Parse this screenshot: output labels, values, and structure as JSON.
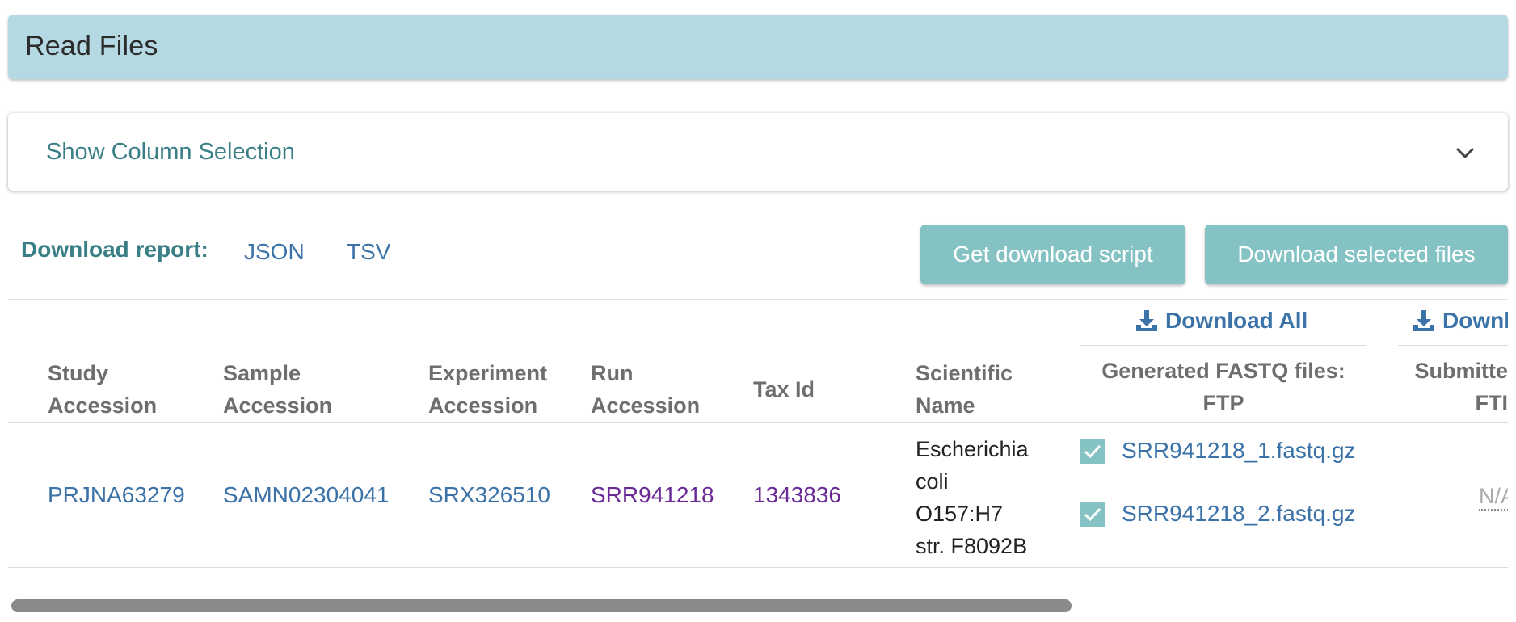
{
  "header": {
    "title": "Read Files"
  },
  "column_selection": {
    "label": "Show Column Selection",
    "icon": "chevron-down-icon"
  },
  "report": {
    "label": "Download report:",
    "json": "JSON",
    "tsv": "TSV"
  },
  "buttons": {
    "get_script": "Get download script",
    "download_selected": "Download selected files"
  },
  "table": {
    "download_all": "Download All",
    "download_all_partial": "Downl",
    "headers": {
      "study": [
        "Study",
        "Accession"
      ],
      "sample": [
        "Sample",
        "Accession"
      ],
      "experiment": [
        "Experiment",
        "Accession"
      ],
      "run": [
        "Run",
        "Accession"
      ],
      "tax": "Tax Id",
      "scientific": [
        "Scientific",
        "Name"
      ],
      "fastq": [
        "Generated FASTQ files:",
        "FTP"
      ],
      "submitted": [
        "Submitte",
        "FTI"
      ]
    },
    "row": {
      "study": "PRJNA63279",
      "sample": "SAMN02304041",
      "experiment": "SRX326510",
      "run": "SRR941218",
      "tax_id": "1343836",
      "scientific_name": [
        "Escherichia",
        "coli",
        "O157:H7",
        "str. F8092B"
      ],
      "files": [
        {
          "name": "SRR941218_1.fastq.gz",
          "checked": true
        },
        {
          "name": "SRR941218_2.fastq.gz",
          "checked": true
        }
      ],
      "submitted": "N/A"
    }
  },
  "colors": {
    "header_bg": "#b5d9e3",
    "accent": "#3a7f86",
    "button": "#84c2c3",
    "link": "#3b72a8",
    "visited": "#6a2a96"
  }
}
